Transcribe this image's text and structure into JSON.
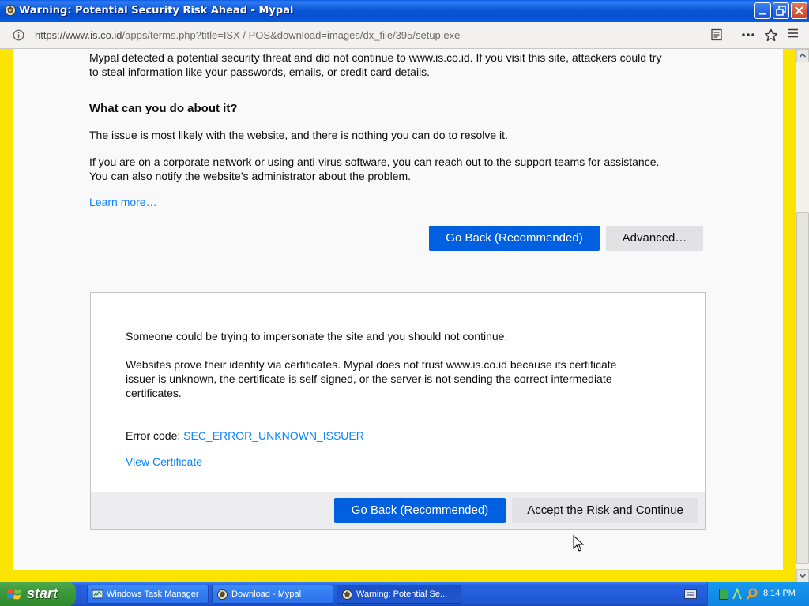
{
  "window": {
    "title": "Warning: Potential Security Risk Ahead - Mypal"
  },
  "navbar": {
    "url_host": "https://www.is.co.id",
    "url_path": "/apps/terms.php?title=ISX / POS&download=images/dx_file/395/setup.exe"
  },
  "page": {
    "intro": "Mypal detected a potential security threat and did not continue to www.is.co.id. If you visit this site, attackers could try to steal information like your passwords, emails, or credit card details.",
    "intro_line1": "Mypal detected a potential security threat and did not continue to www.is.co.id. If you visit this site, attackers could try",
    "intro_line2": "to steal information like your passwords, emails, or credit card details.",
    "what_heading": "What can you do about it?",
    "what_text": "The issue is most likely with the website, and there is nothing you can do to resolve it.",
    "corp_line1": "If you are on a corporate network or using anti-virus software, you can reach out to the support teams for assistance.",
    "corp_line2": "You can also notify the website’s administrator about the problem.",
    "learn_more": "Learn more…",
    "go_back": "Go Back (Recommended)",
    "advanced": "Advanced…"
  },
  "advanced_panel": {
    "impersonate": "Someone could be trying to impersonate the site and you should not continue.",
    "cert_line1": "Websites prove their identity via certificates. Mypal does not trust www.is.co.id because its certificate",
    "cert_line2": "issuer is unknown, the certificate is self-signed, or the server is not sending the correct intermediate",
    "cert_line3": "certificates.",
    "error_label": "Error code:",
    "error_code": "SEC_ERROR_UNKNOWN_ISSUER",
    "view_cert": "View Certificate",
    "go_back": "Go Back (Recommended)",
    "accept": "Accept the Risk and Continue"
  },
  "taskbar": {
    "start": "start",
    "tasks": [
      {
        "label": "Windows Task Manager",
        "icon": "task-manager-icon"
      },
      {
        "label": "Download - Mypal",
        "icon": "mypal-icon"
      },
      {
        "label": "Warning: Potential Se...",
        "icon": "mypal-icon"
      }
    ],
    "clock": "8:14 PM"
  },
  "colors": {
    "accent": "#0060df",
    "link": "#0a84ff",
    "frame": "#fbe400"
  }
}
